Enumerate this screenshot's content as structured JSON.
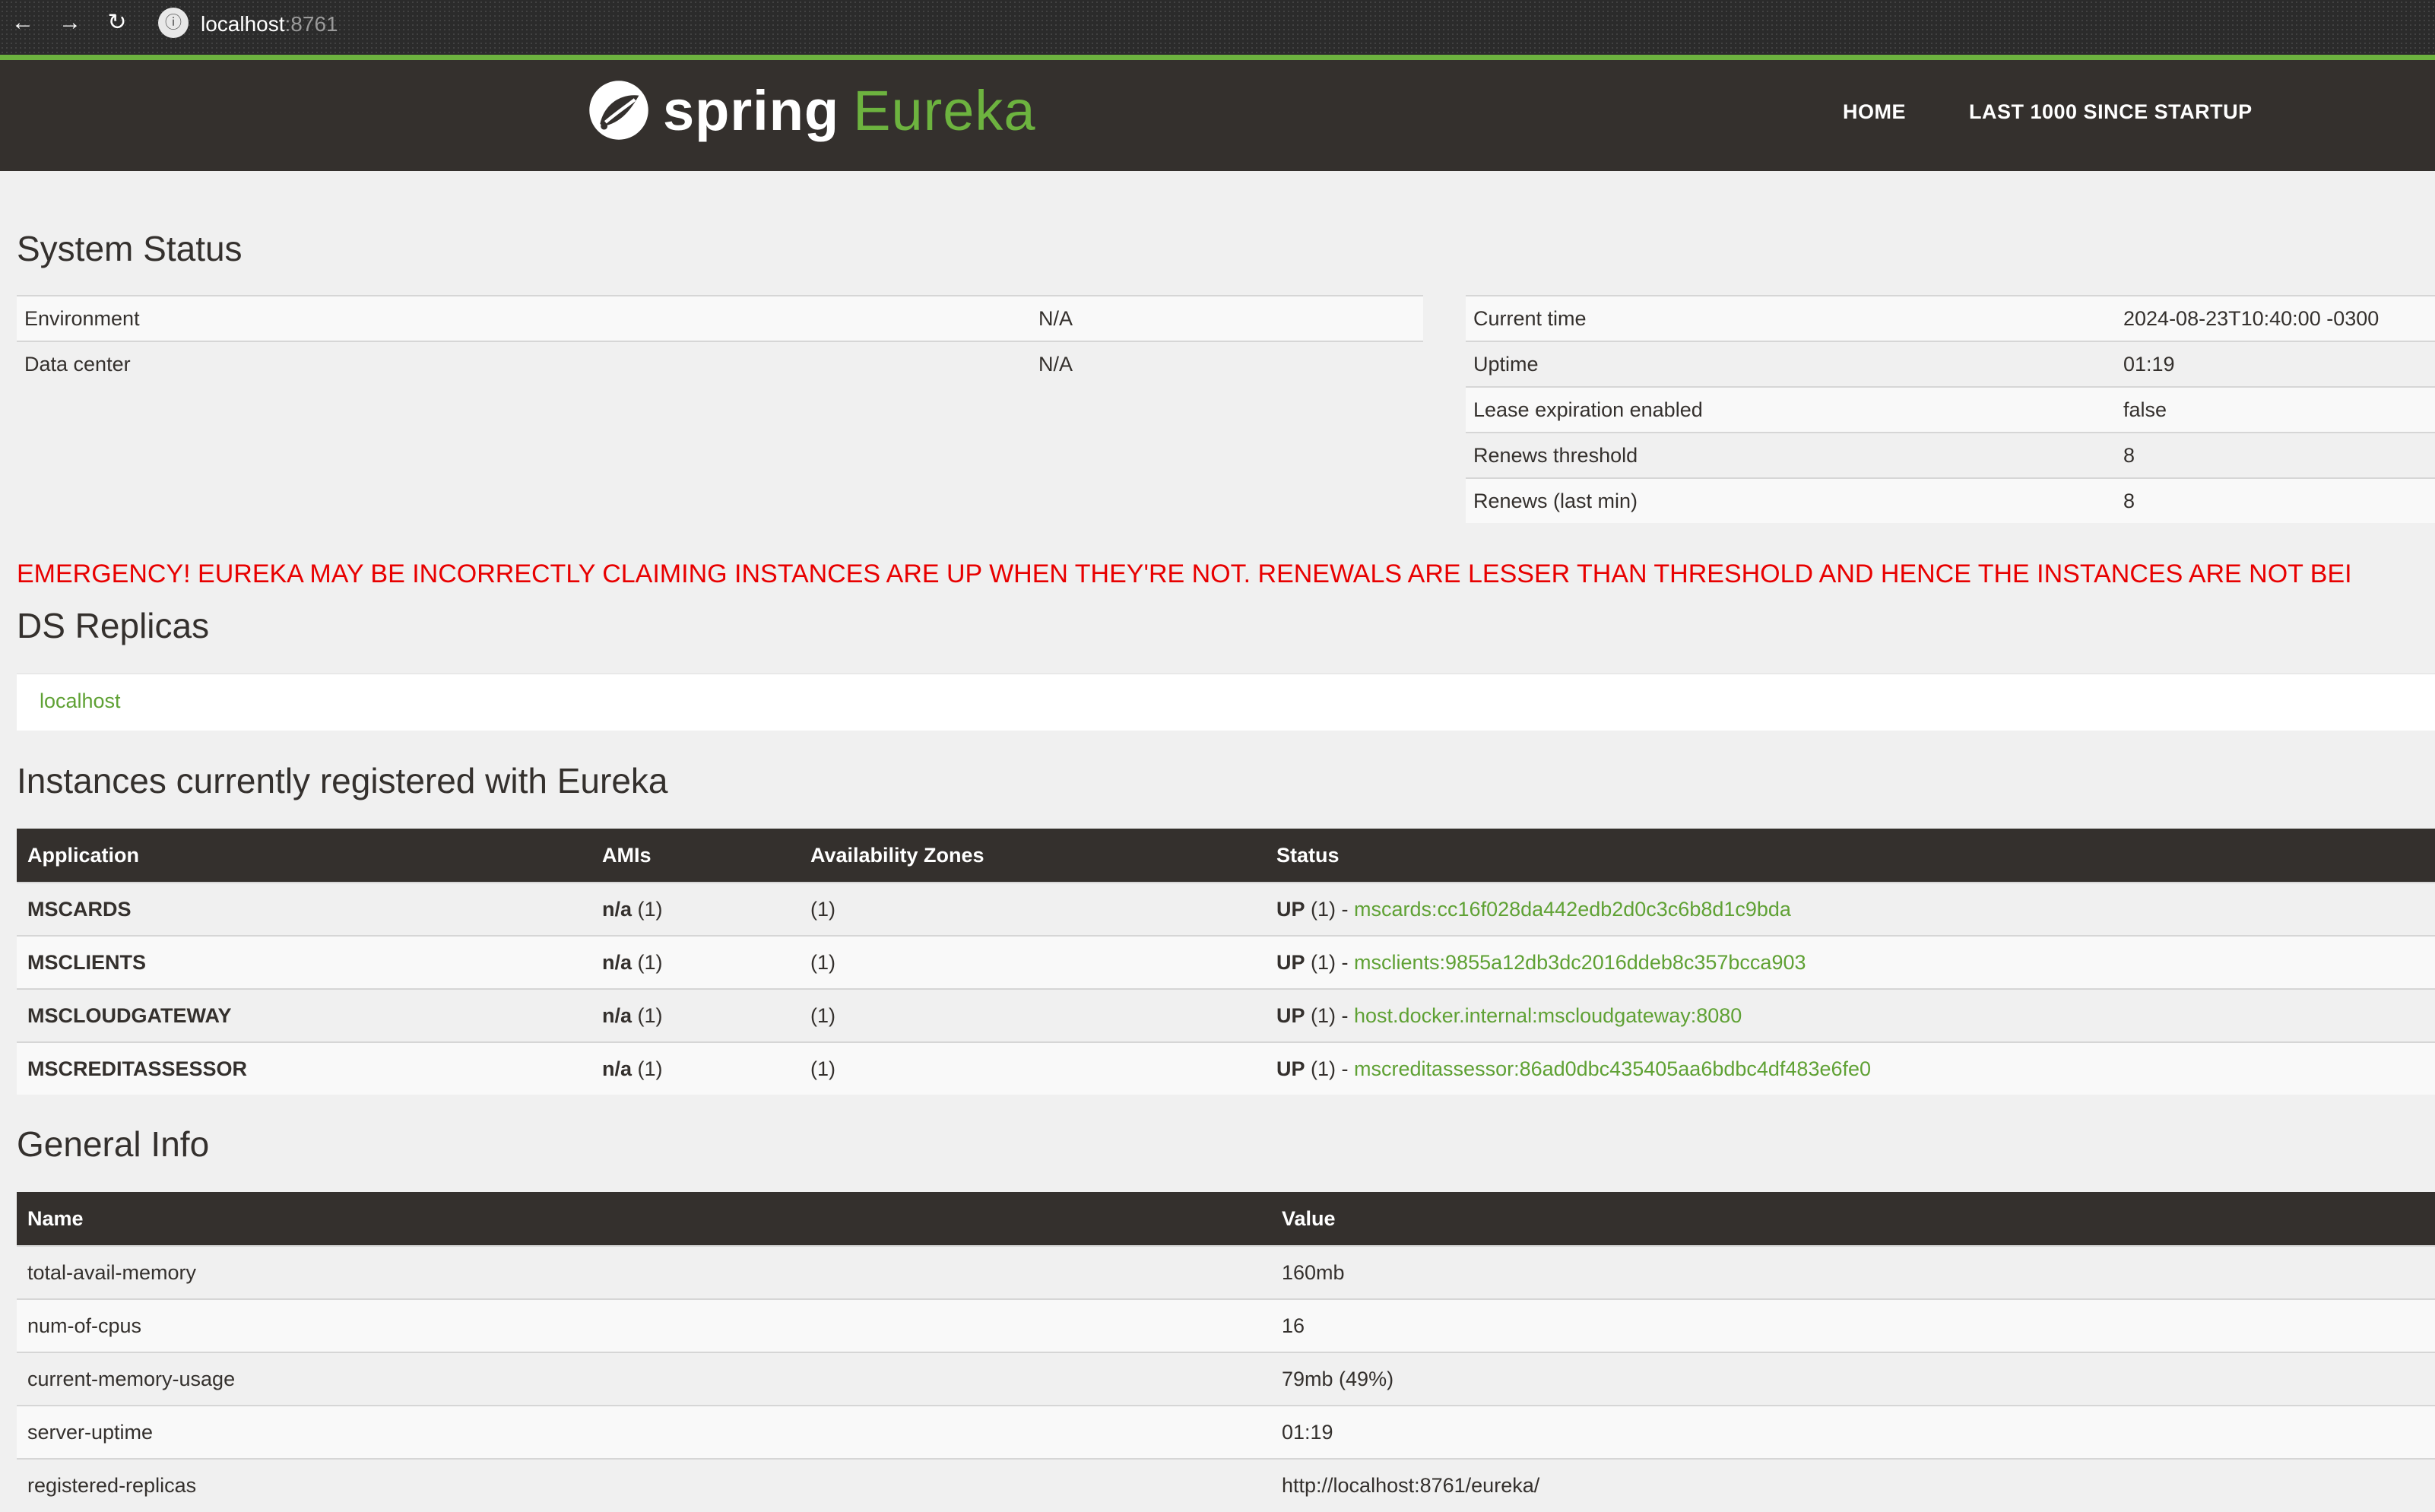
{
  "browser": {
    "url_host": "localhost",
    "url_port": ":8761"
  },
  "header": {
    "logo_spring": "spring",
    "logo_eureka": "Eureka",
    "nav": [
      "HOME",
      "LAST 1000 SINCE STARTUP"
    ]
  },
  "system_status": {
    "title": "System Status",
    "left": [
      {
        "label": "Environment",
        "value": "N/A"
      },
      {
        "label": "Data center",
        "value": "N/A"
      }
    ],
    "right": [
      {
        "label": "Current time",
        "value": "2024-08-23T10:40:00 -0300"
      },
      {
        "label": "Uptime",
        "value": "01:19"
      },
      {
        "label": "Lease expiration enabled",
        "value": "false"
      },
      {
        "label": "Renews threshold",
        "value": "8"
      },
      {
        "label": "Renews (last min)",
        "value": "8"
      }
    ]
  },
  "emergency": "EMERGENCY! EUREKA MAY BE INCORRECTLY CLAIMING INSTANCES ARE UP WHEN THEY'RE NOT. RENEWALS ARE LESSER THAN THRESHOLD AND HENCE THE INSTANCES ARE NOT BEI",
  "ds_replicas": {
    "title": "DS Replicas",
    "items": [
      "localhost"
    ]
  },
  "instances": {
    "title": "Instances currently registered with Eureka",
    "headers": [
      "Application",
      "AMIs",
      "Availability Zones",
      "Status"
    ],
    "rows": [
      {
        "app": "MSCARDS",
        "ami_bold": "n/a",
        "ami_count": " (1)",
        "zones": "(1)",
        "status_bold": "UP",
        "status_count": " (1) - ",
        "link": "mscards:cc16f028da442edb2d0c3c6b8d1c9bda"
      },
      {
        "app": "MSCLIENTS",
        "ami_bold": "n/a",
        "ami_count": " (1)",
        "zones": "(1)",
        "status_bold": "UP",
        "status_count": " (1) - ",
        "link": "msclients:9855a12db3dc2016ddeb8c357bcca903"
      },
      {
        "app": "MSCLOUDGATEWAY",
        "ami_bold": "n/a",
        "ami_count": " (1)",
        "zones": "(1)",
        "status_bold": "UP",
        "status_count": " (1) - ",
        "link": "host.docker.internal:mscloudgateway:8080"
      },
      {
        "app": "MSCREDITASSESSOR",
        "ami_bold": "n/a",
        "ami_count": " (1)",
        "zones": "(1)",
        "status_bold": "UP",
        "status_count": " (1) - ",
        "link": "mscreditassessor:86ad0dbc435405aa6bdbc4df483e6fe0"
      }
    ]
  },
  "general_info": {
    "title": "General Info",
    "headers": [
      "Name",
      "Value"
    ],
    "rows": [
      {
        "name": "total-avail-memory",
        "value": "160mb"
      },
      {
        "name": "num-of-cpus",
        "value": "16"
      },
      {
        "name": "current-memory-usage",
        "value": "79mb (49%)"
      },
      {
        "name": "server-uptime",
        "value": "01:19"
      },
      {
        "name": "registered-replicas",
        "value": "http://localhost:8761/eureka/"
      }
    ]
  }
}
